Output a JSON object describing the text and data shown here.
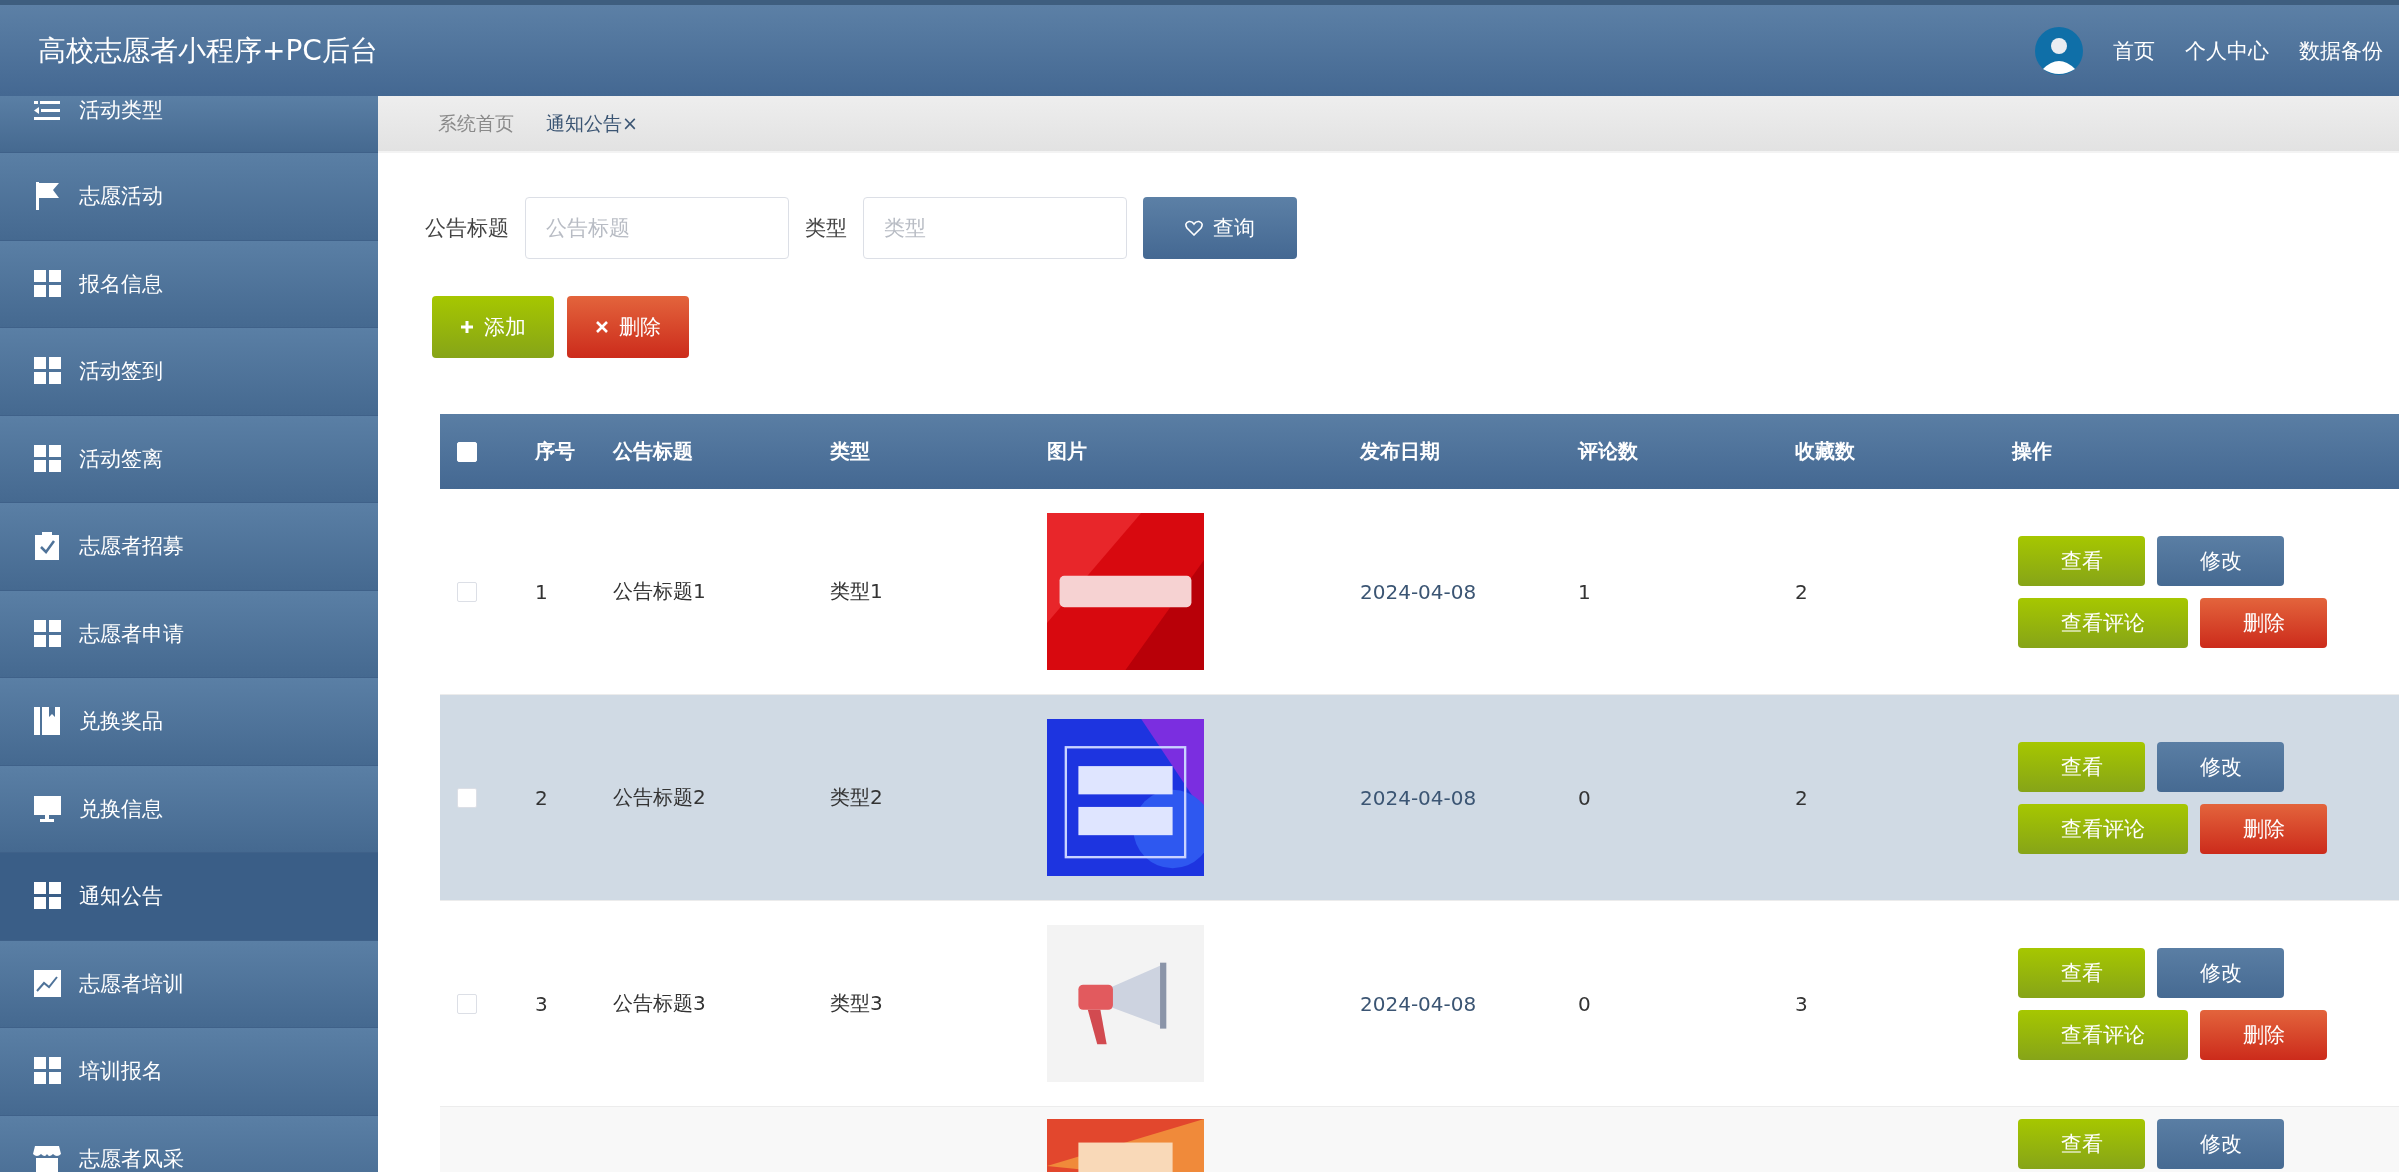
{
  "header": {
    "title": "高校志愿者小程序+PC后台",
    "nav": [
      "首页",
      "个人中心",
      "数据备份"
    ]
  },
  "sidebar": {
    "items": [
      {
        "label": "活动类型",
        "kind": "list",
        "selected": false
      },
      {
        "label": "志愿活动",
        "kind": "flag",
        "selected": false
      },
      {
        "label": "报名信息",
        "kind": "grid",
        "selected": false
      },
      {
        "label": "活动签到",
        "kind": "grid",
        "selected": false
      },
      {
        "label": "活动签离",
        "kind": "grid",
        "selected": false
      },
      {
        "label": "志愿者招募",
        "kind": "clipboard",
        "selected": false
      },
      {
        "label": "志愿者申请",
        "kind": "grid",
        "selected": false
      },
      {
        "label": "兑换奖品",
        "kind": "book",
        "selected": false
      },
      {
        "label": "兑换信息",
        "kind": "monitor",
        "selected": false
      },
      {
        "label": "通知公告",
        "kind": "grid",
        "selected": true
      },
      {
        "label": "志愿者培训",
        "kind": "chart",
        "selected": false
      },
      {
        "label": "培训报名",
        "kind": "grid",
        "selected": false
      },
      {
        "label": "志愿者风采",
        "kind": "shop",
        "selected": false
      }
    ]
  },
  "breadcrumb": [
    {
      "label": "系统首页",
      "selected": false
    },
    {
      "label": "通知公告×",
      "selected": true
    }
  ],
  "search": {
    "fields": [
      {
        "label": "公告标题",
        "placeholder": "公告标题"
      },
      {
        "label": "类型",
        "placeholder": "类型"
      }
    ],
    "button": "查询"
  },
  "toolbar": [
    {
      "label": "添加",
      "kind": "add"
    },
    {
      "label": "删除",
      "kind": "delete"
    }
  ],
  "table": {
    "columns": [
      "序号",
      "公告标题",
      "类型",
      "图片",
      "发布日期",
      "评论数",
      "收藏数",
      "操作"
    ],
    "header_checked": false,
    "rows": [
      {
        "kind": "full",
        "checked": false,
        "highlighted": false,
        "cells": [
          "1",
          "公告标题1",
          "类型1"
        ],
        "image": {
          "kind": "picture"
        },
        "tail": [
          "2024-04-08",
          "1",
          "2"
        ],
        "actions": [
          [
            {
              "label": "查看",
              "kind": "view"
            },
            {
              "label": "修改",
              "kind": "edit"
            }
          ],
          [
            {
              "label": "查看评论",
              "kind": "comments"
            },
            {
              "label": "删除",
              "kind": "delete"
            }
          ]
        ]
      },
      {
        "kind": "full",
        "checked": false,
        "highlighted": true,
        "cells": [
          "2",
          "公告标题2",
          "类型2"
        ],
        "image": {
          "kind": "picture"
        },
        "tail": [
          "2024-04-08",
          "0",
          "2"
        ],
        "actions": [
          [
            {
              "label": "查看",
              "kind": "view"
            },
            {
              "label": "修改",
              "kind": "edit"
            }
          ],
          [
            {
              "label": "查看评论",
              "kind": "comments"
            },
            {
              "label": "删除",
              "kind": "delete"
            }
          ]
        ]
      },
      {
        "kind": "full",
        "checked": false,
        "highlighted": false,
        "cells": [
          "3",
          "公告标题3",
          "类型3"
        ],
        "image": {
          "kind": "picture"
        },
        "tail": [
          "2024-04-08",
          "0",
          "3"
        ],
        "actions": [
          [
            {
              "label": "查看",
              "kind": "view"
            },
            {
              "label": "修改",
              "kind": "edit"
            }
          ],
          [
            {
              "label": "查看评论",
              "kind": "comments"
            },
            {
              "label": "删除",
              "kind": "delete"
            }
          ]
        ]
      },
      {
        "kind": "partial",
        "highlighted": false,
        "image": {
          "kind": "picture"
        },
        "actions": [
          [
            {
              "label": "查看",
              "kind": "view"
            },
            {
              "label": "修改",
              "kind": "edit"
            }
          ]
        ]
      }
    ]
  }
}
